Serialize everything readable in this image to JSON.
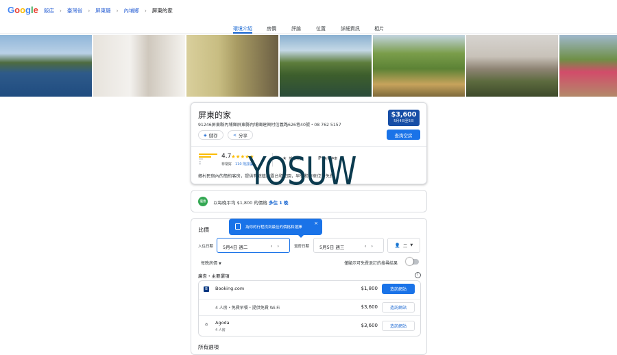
{
  "header": {
    "logo_text": "Google",
    "breadcrumbs": [
      "飯店",
      "臺灣省",
      "屏東縣",
      "內埔鄉",
      "屏東的家"
    ]
  },
  "tabs": [
    "環境介紹",
    "房價",
    "評論",
    "位置",
    "詳細資訊",
    "相片"
  ],
  "active_tab": "環境介紹",
  "hotel": {
    "name": "屏東的家",
    "address": "91246屏東縣內埔鄉屏東縣內埔鄉建興村信義路626巷40號・08 762 5157",
    "save_label": "儲存",
    "share_label": "分享",
    "price": "$3,600",
    "price_dates": "5月4日至5日",
    "check_rooms_label": "查詢空房",
    "rating": "4.7",
    "stars": "★★★★★",
    "rating_word": "非常好",
    "review_count": "110 則評論",
    "amenities": [
      "部分房型",
      "免費停車"
    ],
    "description": "鄉村民宿內的簡約客房，提供有遮蔭的露台和花園，早餐和停車位皆免費。"
  },
  "deal": {
    "icon_text": "優惠",
    "text": "以每晚平均 $1,800 的價格",
    "link": "多住 1 晚"
  },
  "compare": {
    "title": "比價",
    "tooltip": "為你的行程找到最佳的價格和選擇",
    "checkin_label": "入住日期",
    "checkin_value": "5月4日 週二",
    "checkout_label": "退房日期",
    "checkout_value": "5月5日 週三",
    "guests_value": "二",
    "per_night_label": "每晚房價",
    "free_cancel_label": "僅顯示可免費退訂的搜尋結果",
    "section_label": "廣告・主要選項",
    "offers": [
      {
        "provider": "Booking.com",
        "subtitle": "",
        "price": "$1,800",
        "button": "造訪網站",
        "primary": true
      },
      {
        "provider": "",
        "subtitle": "4 人房・免費早餐・提供免費 Wi-Fi",
        "price": "$3,600",
        "button": "造訪網站",
        "primary": false
      },
      {
        "provider": "Agoda",
        "subtitle": "4 人房",
        "price": "$3,600",
        "button": "造訪網站",
        "primary": false
      }
    ],
    "all_options_label": "所有選項"
  },
  "watermark": "YOSUW",
  "colors": {
    "accent": "#1a73e8",
    "price_box": "#174ea6",
    "star": "#fbbc04",
    "deal_icon": "#34a853"
  }
}
